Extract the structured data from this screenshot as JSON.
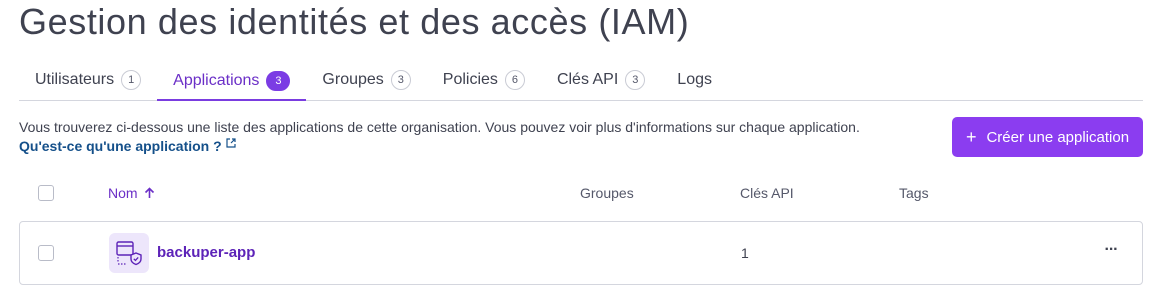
{
  "page": {
    "title": "Gestion des identités et des accès (IAM)"
  },
  "tabs": [
    {
      "label": "Utilisateurs",
      "count": "1",
      "active": false
    },
    {
      "label": "Applications",
      "count": "3",
      "active": true
    },
    {
      "label": "Groupes",
      "count": "3",
      "active": false
    },
    {
      "label": "Policies",
      "count": "6",
      "active": false
    },
    {
      "label": "Clés API",
      "count": "3",
      "active": false
    },
    {
      "label": "Logs",
      "count": null,
      "active": false
    }
  ],
  "description": {
    "text": "Vous trouverez ci-dessous une liste des applications de cette organisation. Vous pouvez voir plus d'informations sur chaque application.",
    "link": "Qu'est-ce qu'une application ?"
  },
  "create_button": {
    "label": "Créer une application",
    "icon": "plus-icon"
  },
  "table": {
    "columns": {
      "name": "Nom",
      "groups": "Groupes",
      "api_keys": "Clés API",
      "tags": "Tags"
    },
    "sort": {
      "column": "Nom",
      "direction": "ascending"
    },
    "rows": [
      {
        "name": "backuper-app",
        "groups": "",
        "api_keys": "1",
        "tags": ""
      }
    ]
  },
  "colors": {
    "accent": "#8b3df0",
    "active_tab": "#6b2fc7",
    "link": "#15508a"
  }
}
